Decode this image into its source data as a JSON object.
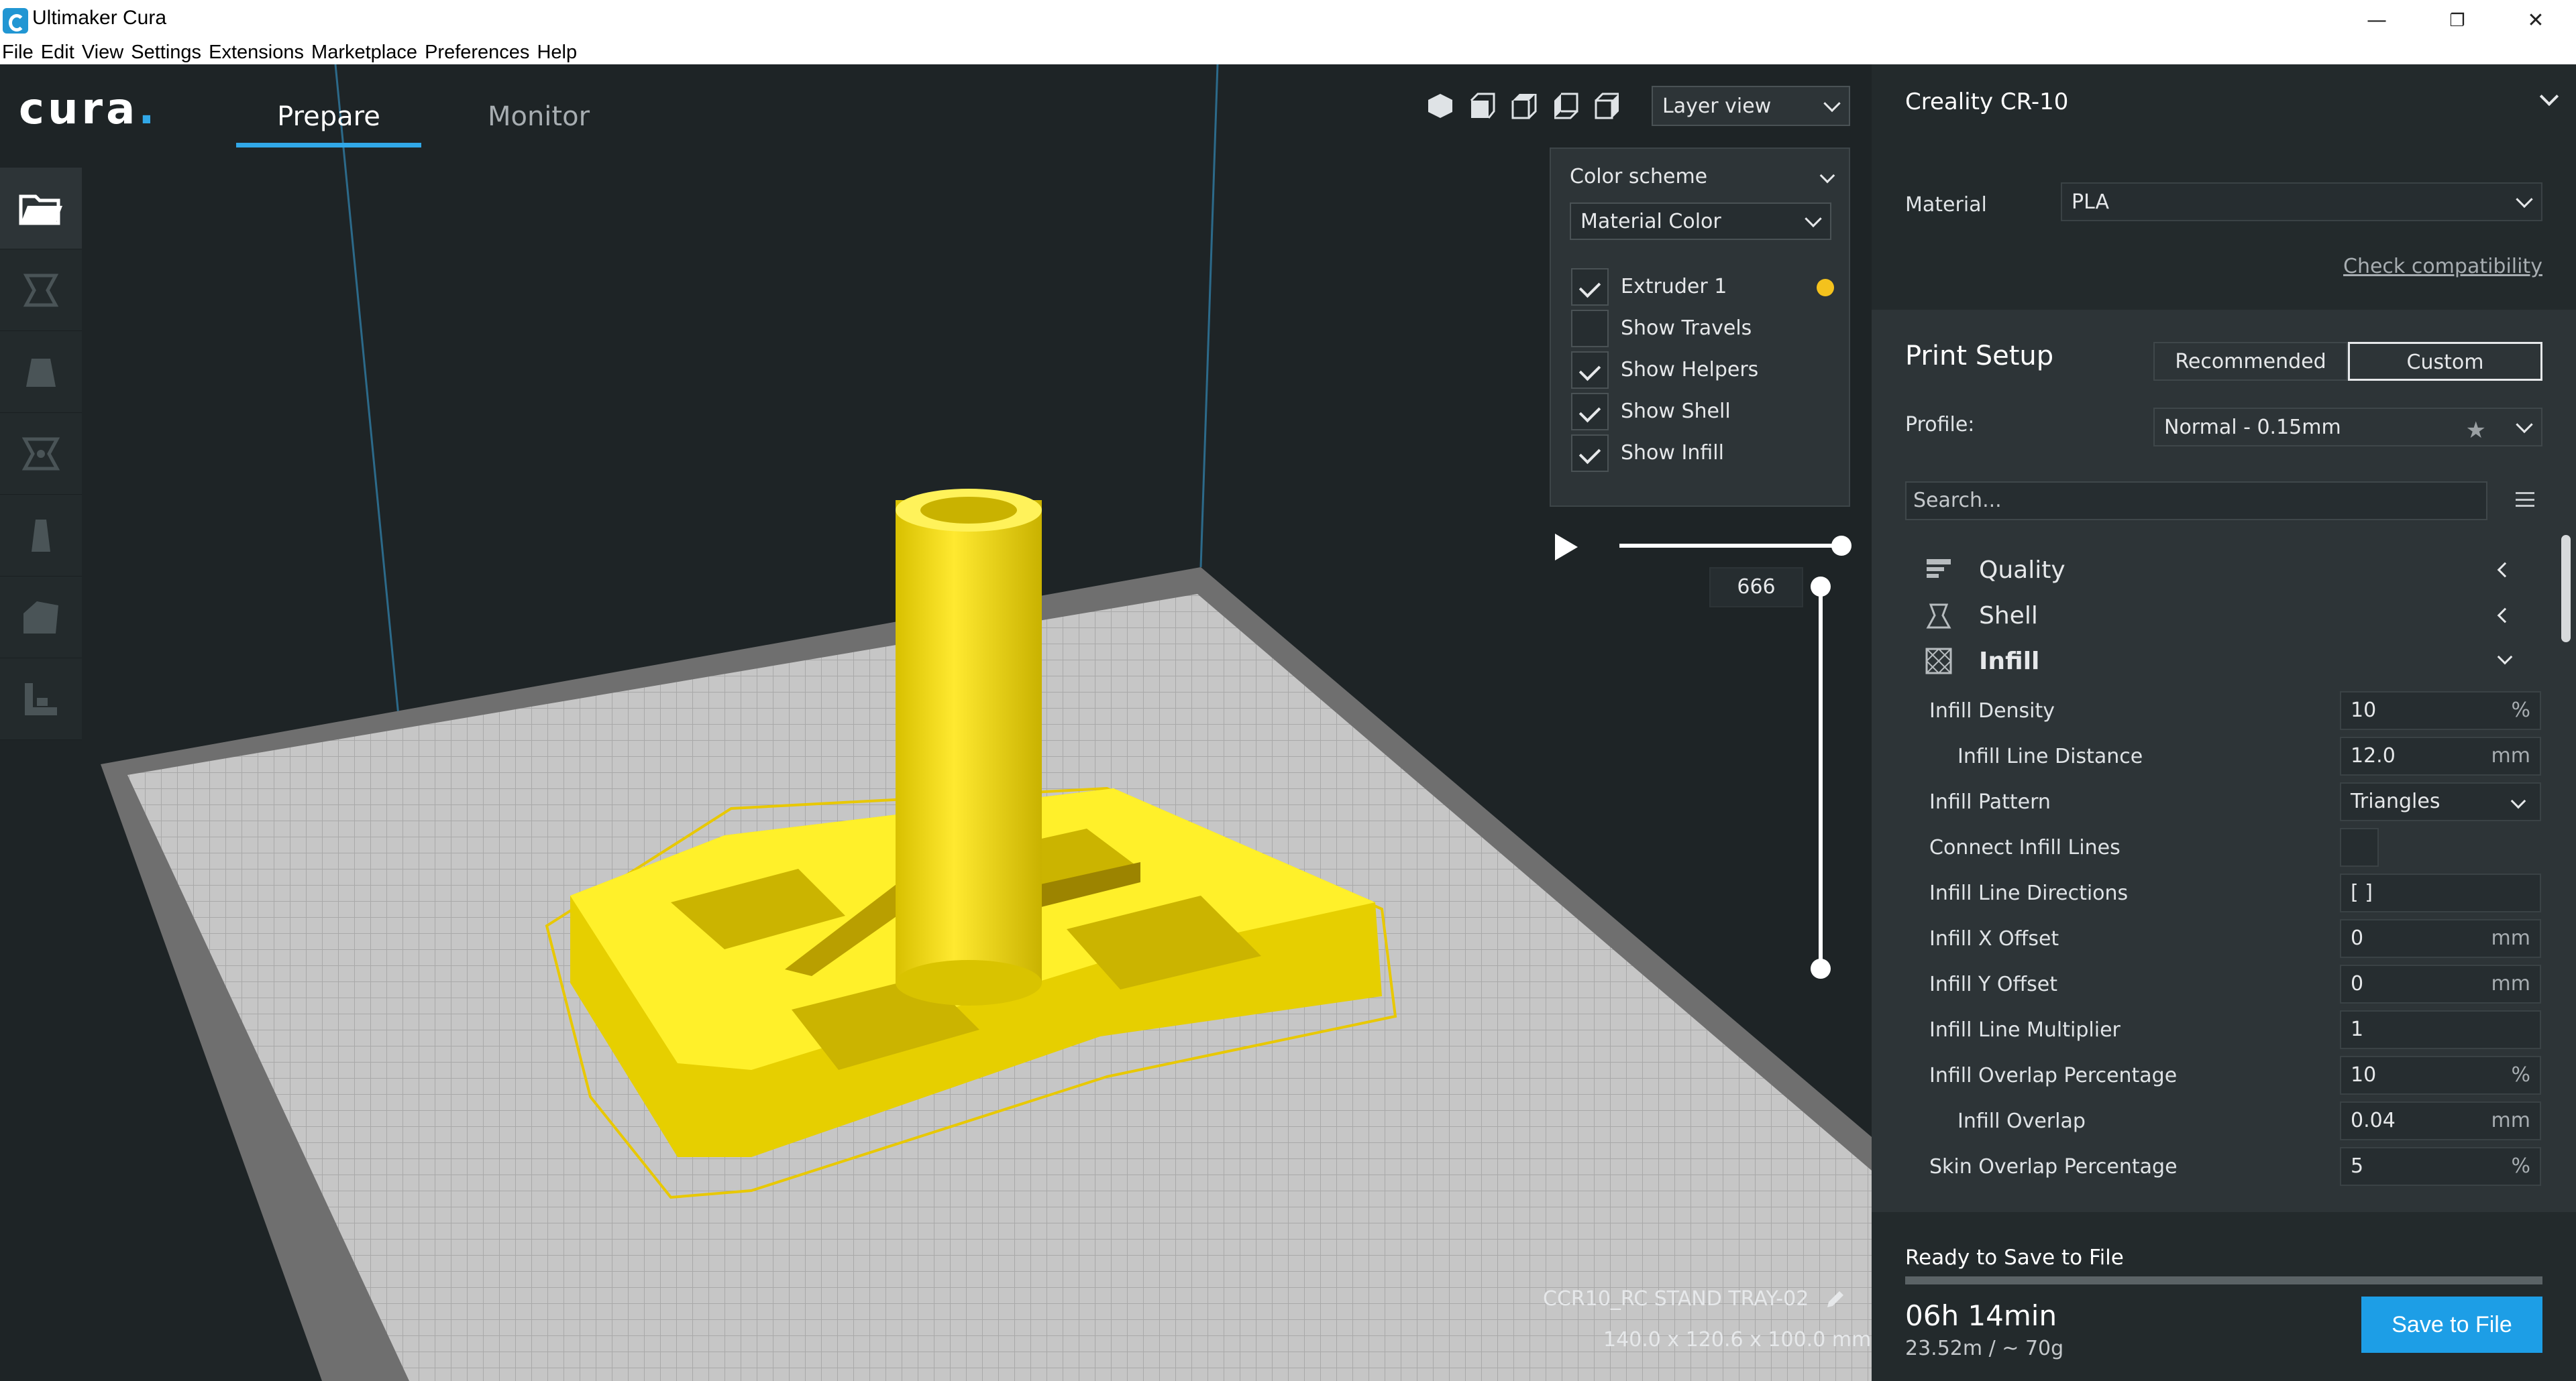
{
  "window": {
    "title": "Ultimaker Cura",
    "minimize": "—",
    "maximize": "❐",
    "close": "✕"
  },
  "menu": [
    "File",
    "Edit",
    "View",
    "Settings",
    "Extensions",
    "Marketplace",
    "Preferences",
    "Help"
  ],
  "header": {
    "logo": "cura",
    "tabs": [
      {
        "label": "Prepare",
        "active": true
      },
      {
        "label": "Monitor",
        "active": false
      }
    ]
  },
  "view": {
    "mode": "Layer view",
    "color_scheme_label": "Color scheme",
    "color_scheme": "Material Color",
    "options": [
      {
        "label": "Extruder 1",
        "checked": true
      },
      {
        "label": "Show Travels",
        "checked": false
      },
      {
        "label": "Show Helpers",
        "checked": true
      },
      {
        "label": "Show Shell",
        "checked": true
      },
      {
        "label": "Show Infill",
        "checked": true
      }
    ],
    "extruder_color": "#f4c21d",
    "layer": "666",
    "object_name": "CCR10_RC STAND TRAY-02",
    "dimensions": "140.0 x 120.6 x 100.0 mm"
  },
  "sidebar": {
    "printer": "Creality CR-10",
    "material_label": "Material",
    "material": "PLA",
    "check_compat": "Check compatibility",
    "print_setup": "Print Setup",
    "mode_recommended": "Recommended",
    "mode_custom": "Custom",
    "profile_label": "Profile:",
    "profile": "Normal - 0.15mm",
    "search_placeholder": "Search...",
    "categories": [
      {
        "label": "Quality"
      },
      {
        "label": "Shell"
      },
      {
        "label": "Infill"
      }
    ],
    "settings": [
      {
        "label": "Infill Density",
        "value": "10",
        "unit": "%",
        "indent": false,
        "type": "text"
      },
      {
        "label": "Infill Line Distance",
        "value": "12.0",
        "unit": "mm",
        "indent": true,
        "type": "text"
      },
      {
        "label": "Infill Pattern",
        "value": "Triangles",
        "unit": "",
        "indent": false,
        "type": "dropdown"
      },
      {
        "label": "Connect Infill Lines",
        "value": "",
        "unit": "",
        "indent": false,
        "type": "checkbox"
      },
      {
        "label": "Infill Line Directions",
        "value": "[ ]",
        "unit": "",
        "indent": false,
        "type": "text"
      },
      {
        "label": "Infill X Offset",
        "value": "0",
        "unit": "mm",
        "indent": false,
        "type": "text"
      },
      {
        "label": "Infill Y Offset",
        "value": "0",
        "unit": "mm",
        "indent": false,
        "type": "text"
      },
      {
        "label": "Infill Line Multiplier",
        "value": "1",
        "unit": "",
        "indent": false,
        "type": "text"
      },
      {
        "label": "Infill Overlap Percentage",
        "value": "10",
        "unit": "%",
        "indent": false,
        "type": "text"
      },
      {
        "label": "Infill Overlap",
        "value": "0.04",
        "unit": "mm",
        "indent": true,
        "type": "text"
      },
      {
        "label": "Skin Overlap Percentage",
        "value": "5",
        "unit": "%",
        "indent": false,
        "type": "text"
      }
    ],
    "ready": "Ready to Save to File",
    "time": "06h 14min",
    "usage": "23.52m / ~ 70g",
    "save": "Save to File"
  },
  "colors": {
    "accent": "#31a8e8",
    "model": "#f4e11d",
    "button": "#1d9ee6"
  }
}
